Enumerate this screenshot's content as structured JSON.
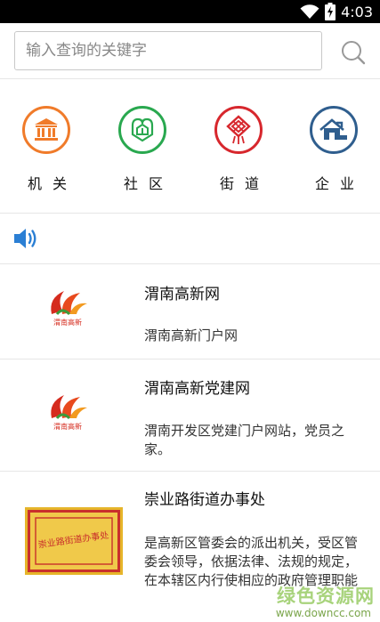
{
  "status_bar": {
    "time": "4:03",
    "wifi_icon": "wifi-icon",
    "battery_icon": "battery-charging-icon"
  },
  "search": {
    "placeholder": "输入查询的关键字",
    "value": "",
    "icon": "search-icon"
  },
  "categories": [
    {
      "label": "机关",
      "icon": "government-building-icon",
      "color": "#f07b2a"
    },
    {
      "label": "社区",
      "icon": "community-icon",
      "color": "#29a84f"
    },
    {
      "label": "街道",
      "icon": "street-knot-icon",
      "color": "#d7272d"
    },
    {
      "label": "企业",
      "icon": "house-icon",
      "color": "#2f5e8e"
    }
  ],
  "speaker": {
    "icon": "speaker-icon",
    "color": "#2b7fd4"
  },
  "list": [
    {
      "title": "渭南高新网",
      "desc": "渭南高新门户网",
      "logo": "weinan-hitech-flame-logo",
      "logo_text": "渭南高新"
    },
    {
      "title": "渭南高新党建网",
      "desc": "渭南开发区党建门户网站，党员之家。",
      "logo": "weinan-hitech-flame-logo",
      "logo_text": "渭南高新"
    },
    {
      "title": "崇业路街道办事处",
      "desc": "是高新区管委会的派出机关，受区管委会领导，依据法律、法规的规定，在本辖区内行使相应的政府管理职能",
      "logo": "plaque-logo",
      "logo_text": "崇业路街道办事处"
    }
  ],
  "watermark": {
    "text": "绿色资源网",
    "url": "www.downcc.com"
  }
}
